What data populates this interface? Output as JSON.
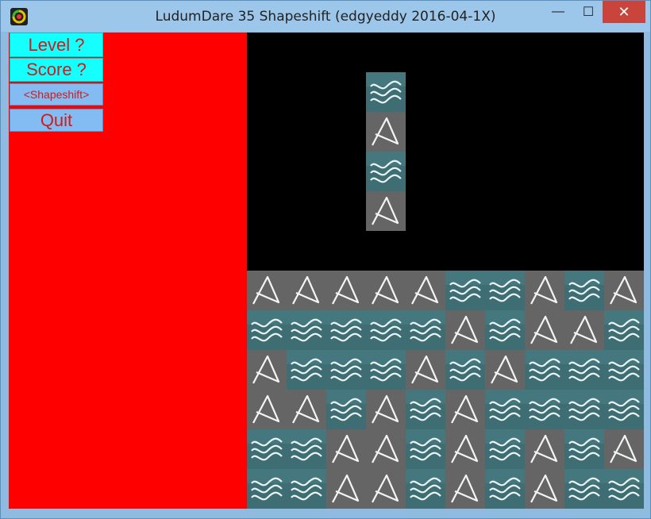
{
  "window": {
    "title": "LudumDare 35 Shapeshift (edgyeddy 2016-04-1X)",
    "controls": {
      "minimize": "—",
      "maximize": "☐",
      "close": "✕"
    }
  },
  "menu": {
    "level_label": "Level ?",
    "score_label": "Score ?",
    "shapeshift_label": "<Shapeshift>",
    "quit_label": "Quit"
  },
  "colors": {
    "left_panel": "#ff0000",
    "board_background": "#000000",
    "water_tile": "#3f6d74",
    "rock_tile": "#6b6b6b",
    "menu_cyan": "#16ffff",
    "menu_blue": "#83bcf3",
    "menu_text": "#d11a1a"
  },
  "game": {
    "tile_types": {
      "W": "water-wave",
      "M": "mountain-rock"
    },
    "falling_piece": {
      "column": 3,
      "top_row": 1,
      "tiles": [
        "W",
        "M",
        "W",
        "M"
      ]
    },
    "board_rows": [
      [
        "M",
        "M",
        "M",
        "M",
        "M",
        "W",
        "W",
        "M",
        "W",
        "M"
      ],
      [
        "W",
        "W",
        "W",
        "W",
        "W",
        "M",
        "W",
        "M",
        "M",
        "W"
      ],
      [
        "M",
        "W",
        "W",
        "W",
        "M",
        "W",
        "M",
        "W",
        "W",
        "W"
      ],
      [
        "M",
        "M",
        "W",
        "M",
        "W",
        "M",
        "W",
        "W",
        "W",
        "W"
      ],
      [
        "W",
        "W",
        "M",
        "M",
        "W",
        "M",
        "W",
        "M",
        "W",
        "M"
      ],
      [
        "W",
        "W",
        "M",
        "M",
        "W",
        "M",
        "W",
        "M",
        "W",
        "W"
      ]
    ],
    "board_top_row": 6
  }
}
